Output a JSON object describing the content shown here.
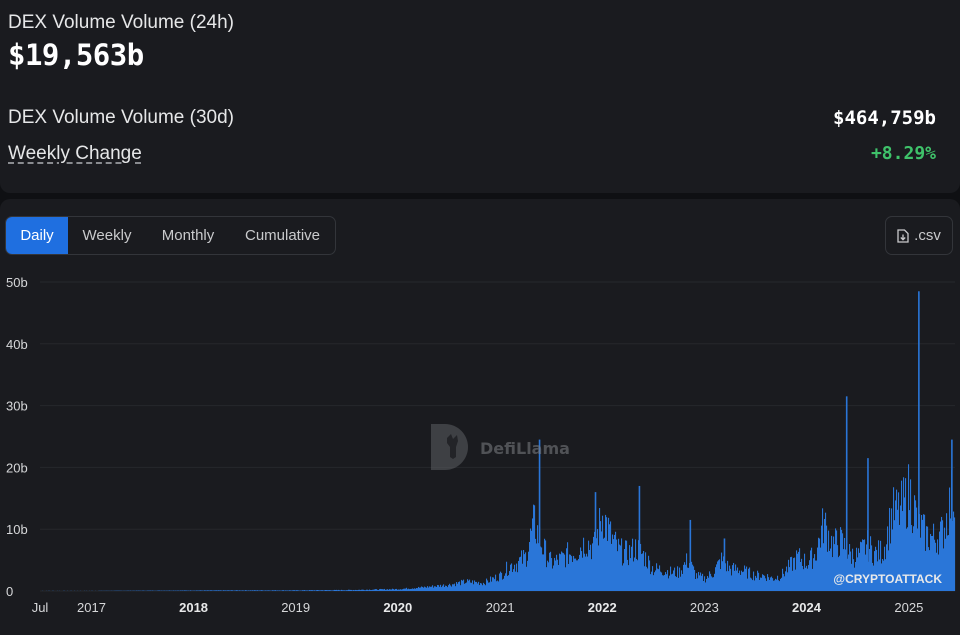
{
  "metrics": {
    "volume_24h_label": "DEX Volume Volume (24h)",
    "volume_24h_value": "$19,563b",
    "volume_30d_label": "DEX Volume Volume (30d)",
    "volume_30d_value": "$464,759b",
    "weekly_change_label": "Weekly Change",
    "weekly_change_value": "+8.29%"
  },
  "tabs": [
    {
      "label": "Daily",
      "active": true
    },
    {
      "label": "Weekly",
      "active": false
    },
    {
      "label": "Monthly",
      "active": false
    },
    {
      "label": "Cumulative",
      "active": false
    }
  ],
  "csv_button": {
    "label": ".csv",
    "icon": "file-download-icon"
  },
  "watermark": {
    "text": "DefiLlama",
    "icon": "llama-logo-icon"
  },
  "credit": "@CRYPTOATTACK",
  "colors": {
    "accent": "#1f6fe0",
    "bars": "#2a76d8",
    "positive": "#3fc26a",
    "background": "#1a1b1f"
  },
  "chart_data": {
    "type": "bar",
    "title": "",
    "xlabel": "",
    "ylabel": "",
    "yticks": [
      "0",
      "10b",
      "20b",
      "30b",
      "40b",
      "50b"
    ],
    "ylim": [
      0,
      50
    ],
    "xlim": [
      "2016-07",
      "2025-06-15"
    ],
    "grid": true,
    "xticks": [
      {
        "label": "Jul",
        "date": "2016-07",
        "bold": false
      },
      {
        "label": "2017",
        "date": "2017-01",
        "bold": false
      },
      {
        "label": "2018",
        "date": "2018-01",
        "bold": true
      },
      {
        "label": "2019",
        "date": "2019-01",
        "bold": false
      },
      {
        "label": "2020",
        "date": "2020-01",
        "bold": true
      },
      {
        "label": "2021",
        "date": "2021-01",
        "bold": false
      },
      {
        "label": "2022",
        "date": "2022-01",
        "bold": true
      },
      {
        "label": "2023",
        "date": "2023-01",
        "bold": false
      },
      {
        "label": "2024",
        "date": "2024-01",
        "bold": true
      },
      {
        "label": "2025",
        "date": "2025-01",
        "bold": false
      }
    ],
    "series": [
      {
        "values_unit": "billions USD (approx. monthly level, daily bars)",
        "x": [
          "2016-07",
          "2017-01",
          "2017-07",
          "2018-01",
          "2018-07",
          "2019-01",
          "2019-07",
          "2020-01",
          "2020-04",
          "2020-07",
          "2020-09",
          "2020-11",
          "2021-01",
          "2021-02",
          "2021-03",
          "2021-04",
          "2021-05",
          "2021-06",
          "2021-07",
          "2021-08",
          "2021-09",
          "2021-10",
          "2021-11",
          "2021-12",
          "2022-01",
          "2022-02",
          "2022-03",
          "2022-04",
          "2022-05",
          "2022-06",
          "2022-07",
          "2022-08",
          "2022-09",
          "2022-10",
          "2022-11",
          "2022-12",
          "2023-01",
          "2023-02",
          "2023-03",
          "2023-04",
          "2023-05",
          "2023-06",
          "2023-07",
          "2023-08",
          "2023-09",
          "2023-10",
          "2023-11",
          "2023-12",
          "2024-01",
          "2024-02",
          "2024-03",
          "2024-04",
          "2024-05",
          "2024-06",
          "2024-07",
          "2024-08",
          "2024-09",
          "2024-10",
          "2024-11",
          "2024-12",
          "2025-01",
          "2025-02",
          "2025-03",
          "2025-04",
          "2025-05",
          "2025-06"
        ],
        "values": [
          0.02,
          0.02,
          0.05,
          0.08,
          0.1,
          0.1,
          0.15,
          0.3,
          0.6,
          1.0,
          1.5,
          1.3,
          2.5,
          4.0,
          4.5,
          5.5,
          11.0,
          7.0,
          4.5,
          5.0,
          6.0,
          6.5,
          8.0,
          7.0,
          12.5,
          8.5,
          6.5,
          6.0,
          7.0,
          5.5,
          3.5,
          3.5,
          3.0,
          3.0,
          5.0,
          2.5,
          2.0,
          3.0,
          5.0,
          3.5,
          3.5,
          3.0,
          2.5,
          2.5,
          2.0,
          2.5,
          4.0,
          5.5,
          4.5,
          6.0,
          11.0,
          7.5,
          8.0,
          6.0,
          5.5,
          7.5,
          6.0,
          6.5,
          12.5,
          13.0,
          16.0,
          11.0,
          9.0,
          8.5,
          9.5,
          15.0
        ]
      }
    ],
    "spikes": [
      {
        "date": "2021-05-19",
        "value": 24.5
      },
      {
        "date": "2021-12-05",
        "value": 16.0
      },
      {
        "date": "2022-05-11",
        "value": 17.0
      },
      {
        "date": "2022-11-09",
        "value": 11.5
      },
      {
        "date": "2023-03-11",
        "value": 8.5
      },
      {
        "date": "2024-05-21",
        "value": 31.5
      },
      {
        "date": "2024-08-05",
        "value": 21.5
      },
      {
        "date": "2025-02-03",
        "value": 48.5
      },
      {
        "date": "2025-06-01",
        "value": 24.5
      }
    ]
  }
}
